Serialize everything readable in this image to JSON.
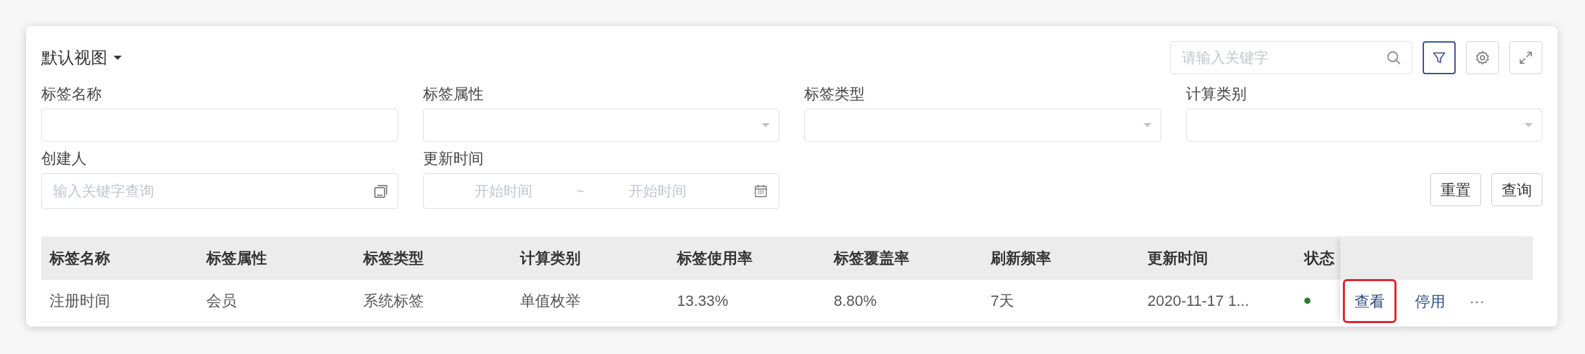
{
  "view_selector": {
    "label": "默认视图"
  },
  "search": {
    "placeholder": "请输入关键字"
  },
  "toolbar": [
    {
      "kind": "filter",
      "selected": true
    },
    {
      "kind": "settings",
      "selected": false
    },
    {
      "kind": "fullscreen",
      "selected": false
    }
  ],
  "filters": [
    {
      "label": "标签名称",
      "kind": "text"
    },
    {
      "label": "标签属性",
      "kind": "select"
    },
    {
      "label": "标签类型",
      "kind": "select"
    },
    {
      "label": "计算类别",
      "kind": "select"
    },
    {
      "label": "创建人",
      "kind": "picker",
      "placeholder": "输入关键字查询"
    },
    {
      "label": "更新时间",
      "kind": "daterange",
      "start_placeholder": "开始时间",
      "separator": "~",
      "end_placeholder": "开始时间"
    }
  ],
  "buttons": [
    "重置",
    "查询"
  ],
  "table": {
    "columns": [
      "标签名称",
      "标签属性",
      "标签类型",
      "计算类别",
      "标签使用率",
      "标签覆盖率",
      "刷新频率",
      "更新时间",
      "状态"
    ],
    "rows": [
      {
        "cells": [
          "注册时间",
          "会员",
          "系统标签",
          "单值枚举",
          "13.33%",
          "8.80%",
          "7天",
          "2020-11-17 1..."
        ],
        "color": "#2e7d32",
        "actions": [
          {
            "label": "查看",
            "highlighted": true
          },
          {
            "label": "停用",
            "highlighted": false
          }
        ],
        "more": "···"
      }
    ]
  }
}
